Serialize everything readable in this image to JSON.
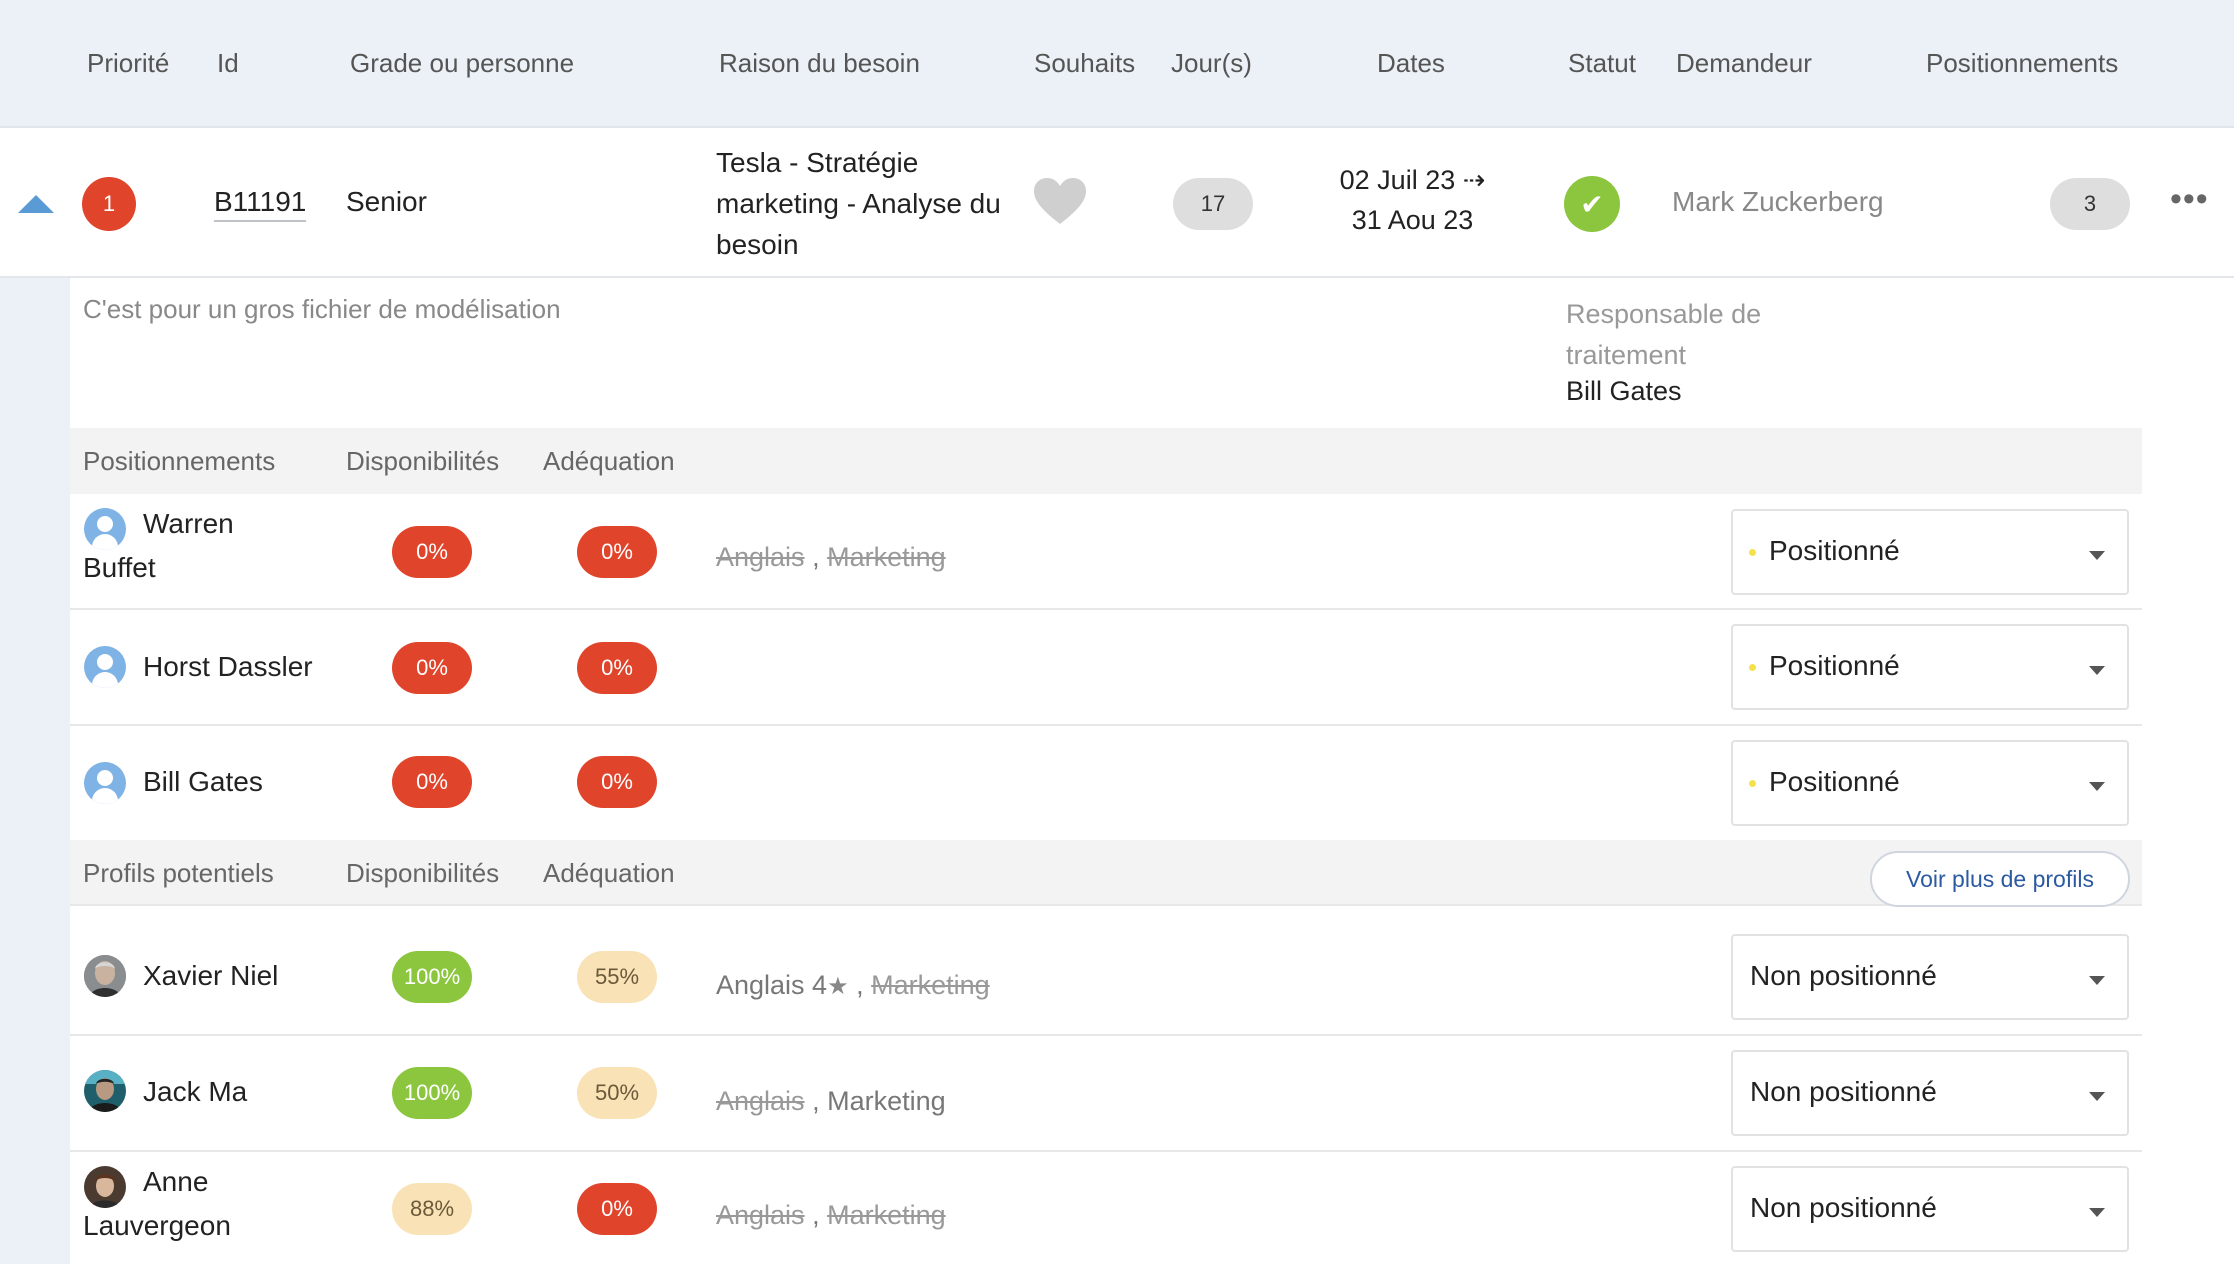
{
  "header": {
    "priority": "Priorité",
    "id": "Id",
    "grade": "Grade ou personne",
    "reason": "Raison du besoin",
    "wishes": "Souhaits",
    "days": "Jour(s)",
    "dates": "Dates",
    "status": "Statut",
    "requester": "Demandeur",
    "positionings": "Positionnements"
  },
  "request": {
    "priority": "1",
    "id": "B11191",
    "grade": "Senior",
    "reason": "Tesla - Stratégie marketing - Analyse du besoin",
    "days": "17",
    "date_start": "02 Juil 23 ⇢",
    "date_end": "31 Aou 23",
    "status_icon": "✔",
    "requester": "Mark Zuckerberg",
    "positionings_count": "3",
    "more": "•••",
    "note": "C'est pour un gros fichier de modélisation",
    "responsible_label": "Responsable de traitement",
    "responsible_name": "Bill Gates"
  },
  "positioned_section": {
    "title": "Positionnements",
    "availability": "Disponibilités",
    "match": "Adéquation"
  },
  "positioned": [
    {
      "name": "Warren Buffet",
      "availability": "0%",
      "match": "0%",
      "skill1": "Anglais",
      "sep": " , ",
      "skill2": "Marketing",
      "status": "Positionné"
    },
    {
      "name": "Horst Dassler",
      "availability": "0%",
      "match": "0%",
      "status": "Positionné"
    },
    {
      "name": "Bill Gates",
      "availability": "0%",
      "match": "0%",
      "status": "Positionné"
    }
  ],
  "potential_section": {
    "title": "Profils potentiels",
    "availability": "Disponibilités",
    "match": "Adéquation",
    "more_button": "Voir plus de profils"
  },
  "potential": [
    {
      "name": "Xavier Niel",
      "availability": "100%",
      "match": "55%",
      "skill1": "Anglais 4",
      "star": "★",
      "sep": " , ",
      "skill2": "Marketing",
      "status": "Non positionné"
    },
    {
      "name": "Jack Ma",
      "availability": "100%",
      "match": "50%",
      "skill1": "Anglais",
      "sep": " , ",
      "skill2": "Marketing",
      "status": "Non positionné"
    },
    {
      "name": "Anne Lauvergeon",
      "availability": "88%",
      "match": "0%",
      "skill1": "Anglais",
      "sep": " , ",
      "skill2": "Marketing",
      "status": "Non positionné"
    }
  ],
  "colors": {
    "header_bg": "#ebf1f7",
    "red": "#e0452c",
    "green": "#8cc63f",
    "peach": "#f9e2b6",
    "accent_blue": "#5b9bd5",
    "link_blue": "#2c5aa0"
  }
}
